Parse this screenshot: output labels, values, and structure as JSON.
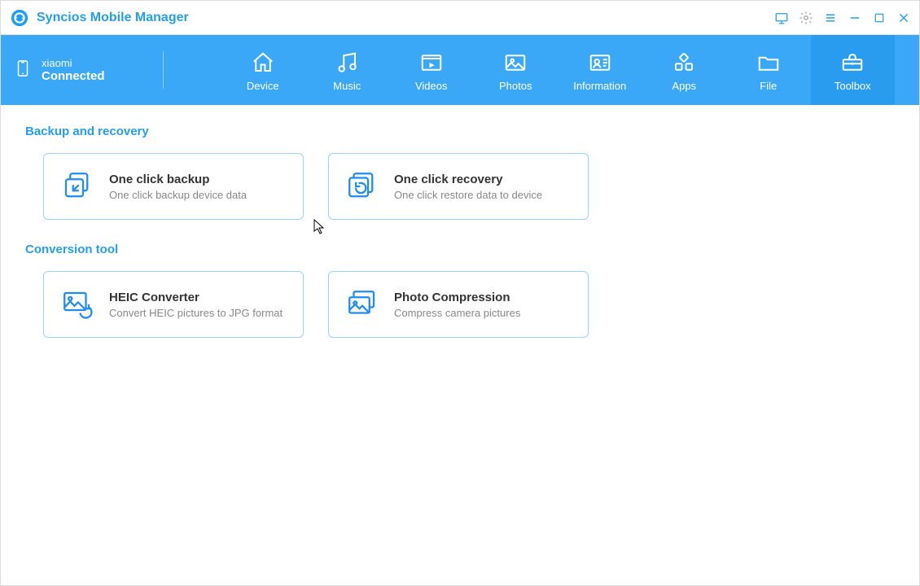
{
  "app": {
    "title": "Syncios Mobile Manager"
  },
  "titlebar_icons": {
    "monitor": "monitor-icon",
    "settings": "gear-icon",
    "menu": "menu-icon",
    "minimize": "minimize-icon",
    "maximize": "maximize-icon",
    "close": "close-icon"
  },
  "device": {
    "name": "xiaomi",
    "status": "Connected"
  },
  "nav": {
    "items": [
      {
        "label": "Device",
        "icon": "home-icon",
        "active": false
      },
      {
        "label": "Music",
        "icon": "music-icon",
        "active": false
      },
      {
        "label": "Videos",
        "icon": "video-icon",
        "active": false
      },
      {
        "label": "Photos",
        "icon": "photo-icon",
        "active": false
      },
      {
        "label": "Information",
        "icon": "contact-icon",
        "active": false
      },
      {
        "label": "Apps",
        "icon": "apps-icon",
        "active": false
      },
      {
        "label": "File",
        "icon": "folder-icon",
        "active": false
      },
      {
        "label": "Toolbox",
        "icon": "toolbox-icon",
        "active": true
      }
    ]
  },
  "sections": {
    "backup": {
      "title": "Backup and recovery",
      "tiles": [
        {
          "title": "One click backup",
          "desc": "One click backup device data",
          "icon": "backup-icon"
        },
        {
          "title": "One click recovery",
          "desc": "One click restore data to device",
          "icon": "recovery-icon"
        }
      ]
    },
    "conversion": {
      "title": "Conversion tool",
      "tiles": [
        {
          "title": "HEIC Converter",
          "desc": "Convert HEIC pictures to JPG format",
          "icon": "heic-icon"
        },
        {
          "title": "Photo Compression",
          "desc": "Compress camera pictures",
          "icon": "compress-icon"
        }
      ]
    }
  }
}
